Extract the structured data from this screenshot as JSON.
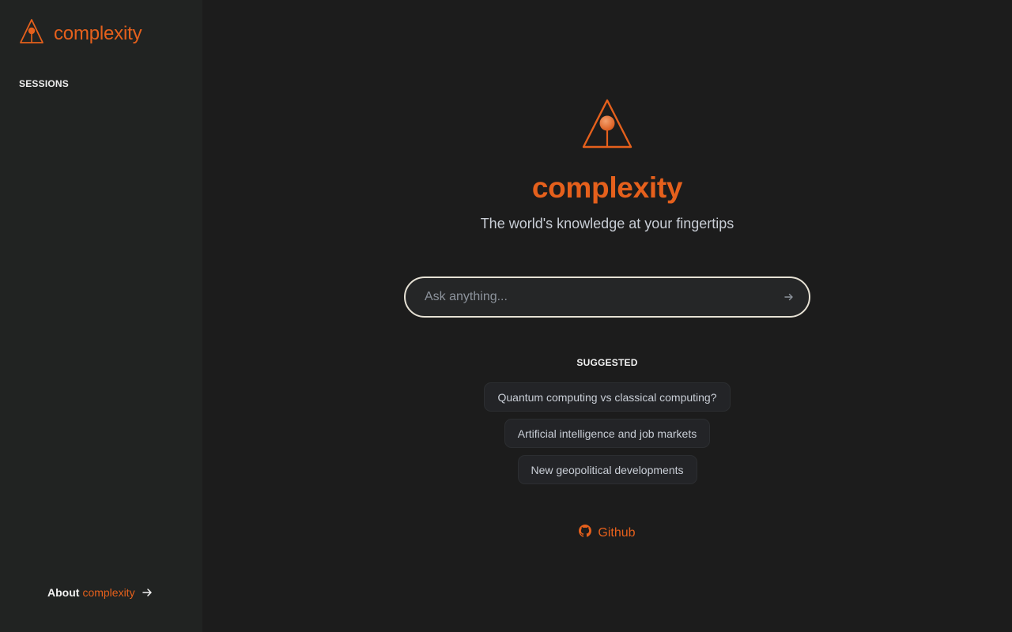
{
  "sidebar": {
    "brand_name": "complexity",
    "sessions_label": "SESSIONS",
    "about_prefix": "About",
    "about_brand": "complexity"
  },
  "main": {
    "title": "complexity",
    "tagline": "The world's knowledge at your fingertips",
    "search": {
      "placeholder": "Ask anything...",
      "value": ""
    },
    "suggested_label": "SUGGESTED",
    "suggestions": [
      "Quantum computing vs classical computing?",
      "Artificial intelligence and job markets",
      "New geopolitical developments"
    ],
    "github_label": "Github"
  },
  "icons": {
    "logo": "triangle-pin-logo-icon",
    "about_arrow": "arrow-right-icon",
    "submit": "arrow-right-icon",
    "github": "github-icon"
  },
  "colors": {
    "accent": "#e5601c",
    "sidebar_bg": "#212322",
    "main_bg": "#1c1c1c",
    "search_border": "#e6e1d4",
    "chip_bg": "#232427"
  }
}
